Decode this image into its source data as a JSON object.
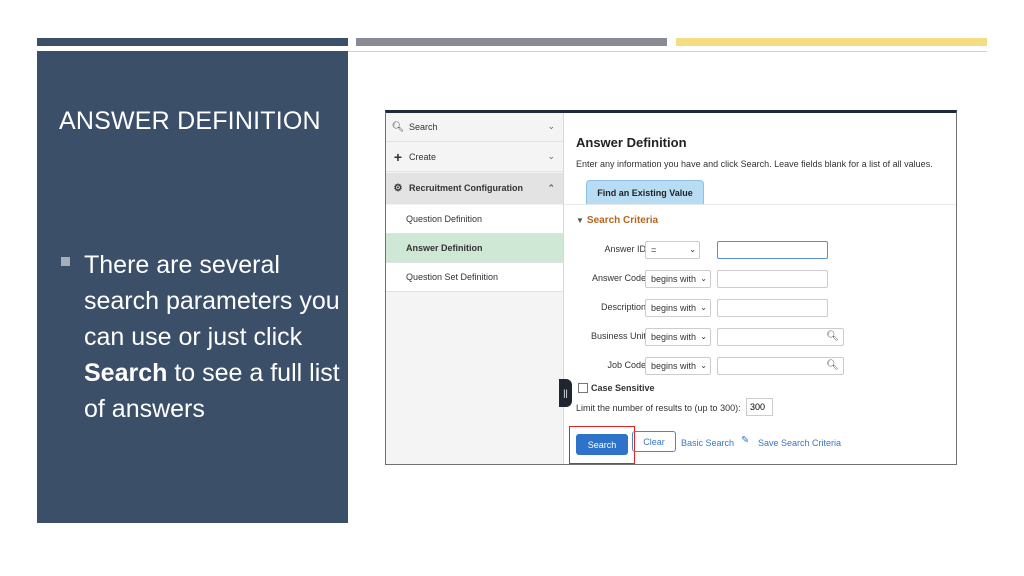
{
  "slide": {
    "title": "ANSWER DEFINITION",
    "bullet": {
      "before": "There are several search parameters you can use or just click ",
      "bold": "Search",
      "after": " to see a full list of answers"
    },
    "colors": {
      "panel": "#3b4f69",
      "bar_gray": "#888b96",
      "bar_yellow": "#f4dd82"
    }
  },
  "screenshot": {
    "nav": {
      "items": [
        {
          "label": "Search",
          "icon": "search-icon",
          "chevron": "⌄"
        },
        {
          "label": "Create",
          "icon": "plus-icon",
          "chevron": "⌄"
        },
        {
          "label": "Recruitment Configuration",
          "icon": "gear-icon",
          "chevron": "⌃"
        }
      ],
      "subitems": [
        {
          "label": "Question Definition"
        },
        {
          "label": "Answer Definition",
          "active": true
        },
        {
          "label": "Question Set Definition"
        }
      ]
    },
    "main": {
      "title": "Answer Definition",
      "description": "Enter any information you have and click Search. Leave fields blank for a list of all values.",
      "tab": "Find an Existing Value",
      "criteria_label": "Search Criteria",
      "fields": [
        {
          "label": "Answer ID",
          "operator": "=",
          "value": ""
        },
        {
          "label": "Answer Code",
          "operator": "begins with",
          "value": ""
        },
        {
          "label": "Description",
          "operator": "begins with",
          "value": ""
        },
        {
          "label": "Business Unit",
          "operator": "begins with",
          "value": ""
        },
        {
          "label": "Job Code",
          "operator": "begins with",
          "value": ""
        }
      ],
      "case_sensitive_label": "Case Sensitive",
      "limit_label": "Limit the number of results to (up to 300):",
      "limit_value": "300",
      "buttons": {
        "search": "Search",
        "clear": "Clear",
        "basic_search": "Basic Search",
        "save_criteria": "Save Search Criteria"
      }
    }
  }
}
